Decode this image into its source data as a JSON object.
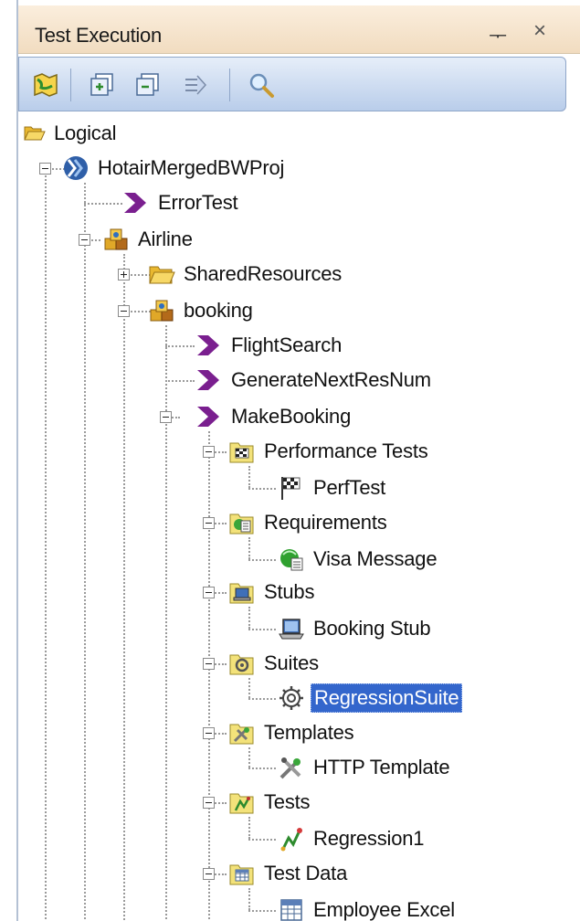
{
  "panel": {
    "title": "Test Execution",
    "pin_glyph": "ᅮ",
    "close_glyph": "×"
  },
  "toolbar": {
    "buttons": [
      {
        "icon": "map-icon"
      },
      {
        "icon": "expand-all-icon"
      },
      {
        "icon": "collapse-all-icon"
      },
      {
        "icon": "filter-icon"
      },
      {
        "icon": "search-icon"
      }
    ]
  },
  "tree": {
    "logical": "Logical",
    "project": "HotairMergedBWProj",
    "error_test": "ErrorTest",
    "airline": "Airline",
    "shared_resources": "SharedResources",
    "booking": "booking",
    "flight_search": "FlightSearch",
    "generate_next_res_num": "GenerateNextResNum",
    "make_booking": "MakeBooking",
    "performance_tests": "Performance Tests",
    "perf_test": "PerfTest",
    "requirements": "Requirements",
    "visa_message": "Visa Message",
    "stubs": "Stubs",
    "booking_stub": "Booking Stub",
    "suites": "Suites",
    "regression_suite": "RegressionSuite",
    "templates": "Templates",
    "http_template": "HTTP Template",
    "tests": "Tests",
    "regression1": "Regression1",
    "test_data": "Test Data",
    "employee_excel": "Employee Excel"
  },
  "colors": {
    "title_bg": "#f1dcc0",
    "toolbar_bg": "#b9cdea",
    "selection": "#3366cc",
    "operation_chevron": "#7a1f8f",
    "folder": "#f3c94a"
  }
}
